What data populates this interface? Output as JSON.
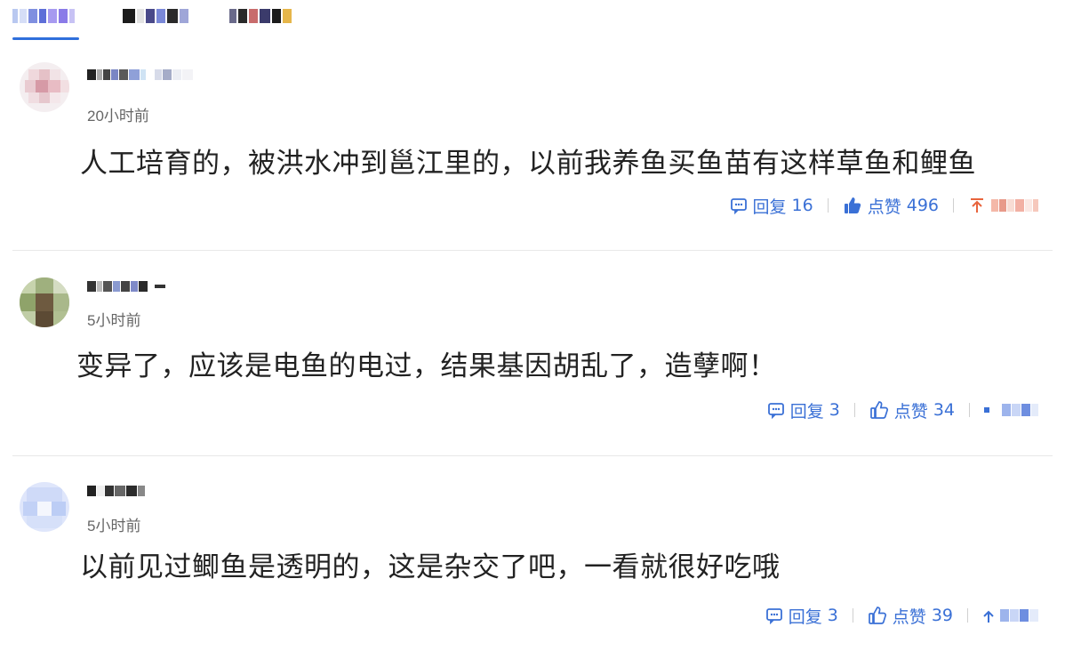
{
  "tabs": [
    {
      "label": "",
      "active": true
    },
    {
      "label": "",
      "active": false
    },
    {
      "label": "",
      "active": false
    }
  ],
  "colors": {
    "accent": "#3a70d6",
    "text": "#222222",
    "muted": "#666666",
    "pin": "#e8643c"
  },
  "comments": [
    {
      "time": "20小时前",
      "text": "人工培育的，被洪水冲到邕江里的，以前我养鱼买鱼苗有这样草鱼和鲤鱼",
      "reply_label": "回复",
      "reply_count": "16",
      "like_label": "点赞",
      "like_count": "496",
      "liked": true,
      "third_icon": "pin-top-icon"
    },
    {
      "time": "5小时前",
      "text": "变异了，应该是电鱼的电过，结果基因胡乱了，造孽啊！",
      "reply_label": "回复",
      "reply_count": "3",
      "like_label": "点赞",
      "like_count": "34",
      "liked": false,
      "third_icon": "more-icon"
    },
    {
      "time": "5小时前",
      "text": "以前见过鲫鱼是透明的，这是杂交了吧，一看就很好吃哦",
      "reply_label": "回复",
      "reply_count": "3",
      "like_label": "点赞",
      "like_count": "39",
      "liked": false,
      "third_icon": "pin-top-icon"
    }
  ]
}
